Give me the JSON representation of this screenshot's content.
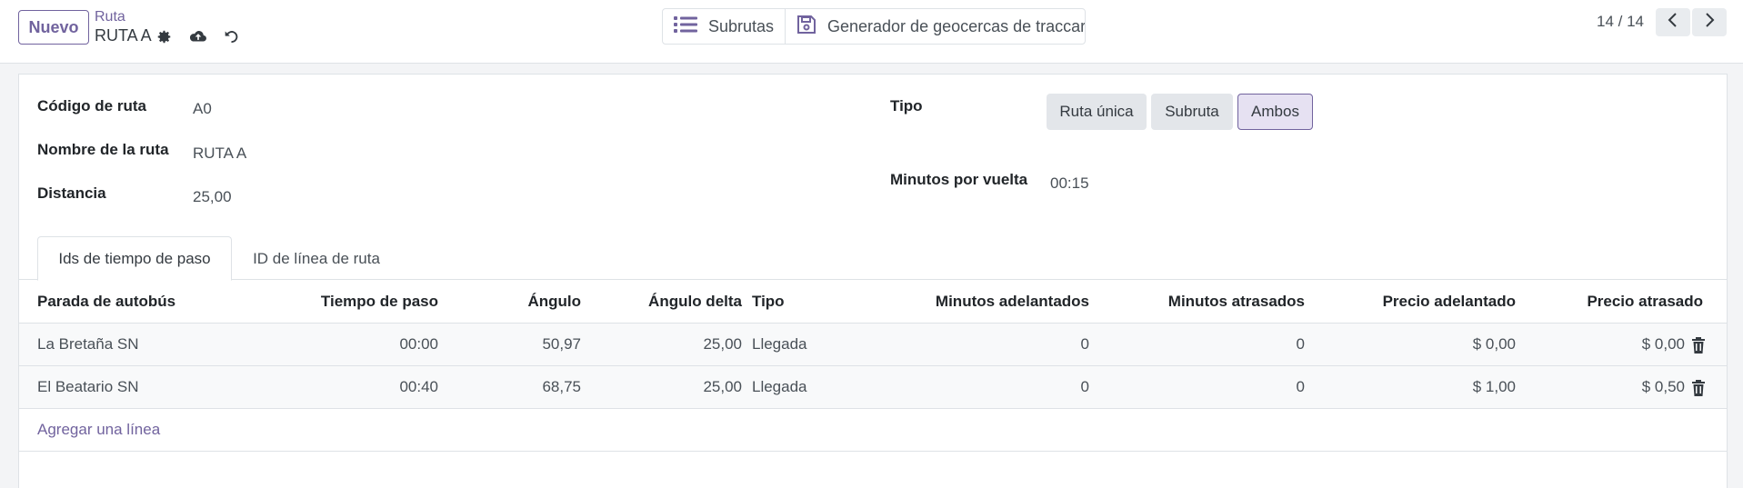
{
  "control_panel": {
    "new_button": "Nuevo",
    "breadcrumb_parent": "Ruta",
    "breadcrumb_current": "RUTA A",
    "stat_buttons": {
      "subroutes": "Subrutas",
      "geofence_generator": "Generador de geocercas de traccar"
    },
    "pager": "14 / 14"
  },
  "form": {
    "route_code_label": "Código de ruta",
    "route_code_value": "A0",
    "route_name_label": "Nombre de la ruta",
    "route_name_value": "RUTA A",
    "distance_label": "Distancia",
    "distance_value": "25,00",
    "type_label": "Tipo",
    "type_options": [
      "Ruta única",
      "Subruta",
      "Ambos"
    ],
    "type_selected": "Ambos",
    "minutes_label": "Minutos por vuelta",
    "minutes_value": "00:15"
  },
  "tabs": [
    "Ids de tiempo de paso",
    "ID de línea de ruta"
  ],
  "table": {
    "headers": [
      "Parada de autobús",
      "Tiempo de paso",
      "Ángulo",
      "Ángulo delta",
      "Tipo",
      "Minutos adelantados",
      "Minutos atrasados",
      "Precio adelantado",
      "Precio atrasado"
    ],
    "rows": [
      [
        "La Bretaña SN",
        "00:00",
        "50,97",
        "25,00",
        "Llegada",
        "0",
        "0",
        "$ 0,00",
        "$ 0,00"
      ],
      [
        "El Beatario SN",
        "00:40",
        "68,75",
        "25,00",
        "Llegada",
        "0",
        "0",
        "$ 1,00",
        "$ 0,50"
      ]
    ],
    "add_line": "Agregar una línea"
  },
  "colors": {
    "brand": "#71639e",
    "active_radio_bg": "#e6e1f2"
  },
  "icons": [
    "gear-icon",
    "cloud-upload-icon",
    "undo-icon",
    "list-icon",
    "save-icon",
    "chevron-left-icon",
    "chevron-right-icon",
    "trash-icon"
  ]
}
